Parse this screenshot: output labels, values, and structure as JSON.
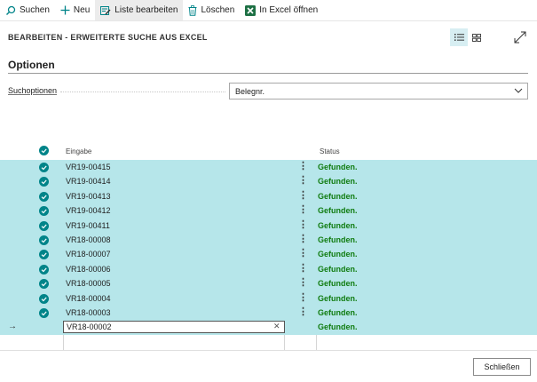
{
  "toolbar": {
    "search_label": "Suchen",
    "new_label": "Neu",
    "edit_list_label": "Liste bearbeiten",
    "delete_label": "Löschen",
    "excel_label": "In Excel öffnen"
  },
  "page": {
    "title": "BEARBEITEN - ERWEITERTE SUCHE AUS EXCEL"
  },
  "options": {
    "section_title": "Optionen",
    "search_options_label": "Suchoptionen",
    "search_options_value": "Belegnr."
  },
  "grid": {
    "columns": {
      "input": "Eingabe",
      "status": "Status"
    },
    "rows": [
      {
        "value": "VR19-00415",
        "status": "Gefunden."
      },
      {
        "value": "VR19-00414",
        "status": "Gefunden."
      },
      {
        "value": "VR19-00413",
        "status": "Gefunden."
      },
      {
        "value": "VR19-00412",
        "status": "Gefunden."
      },
      {
        "value": "VR19-00411",
        "status": "Gefunden."
      },
      {
        "value": "VR18-00008",
        "status": "Gefunden."
      },
      {
        "value": "VR18-00007",
        "status": "Gefunden."
      },
      {
        "value": "VR18-00006",
        "status": "Gefunden."
      },
      {
        "value": "VR18-00005",
        "status": "Gefunden."
      },
      {
        "value": "VR18-00004",
        "status": "Gefunden."
      },
      {
        "value": "VR18-00003",
        "status": "Gefunden."
      }
    ],
    "edit_row": {
      "value": "VR18-00002",
      "status": "Gefunden."
    }
  },
  "footer": {
    "close_label": "Schließen"
  },
  "colors": {
    "accent": "#008489",
    "selected_row": "#b6e6ea",
    "found_status": "#107c10"
  }
}
